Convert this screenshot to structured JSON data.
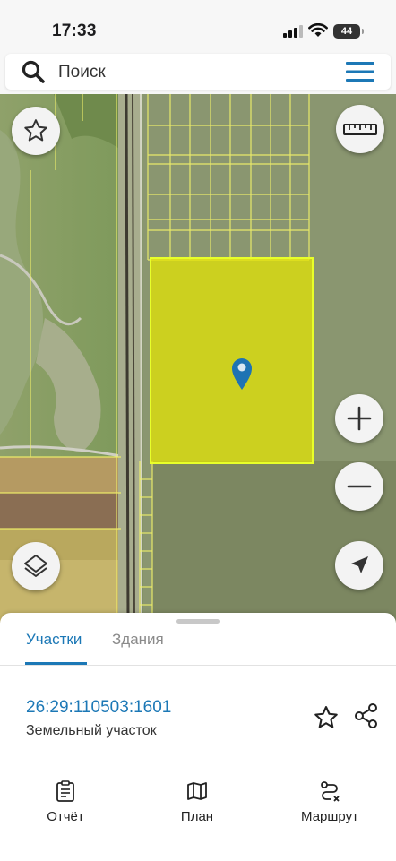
{
  "status_bar": {
    "time": "17:33",
    "battery": "44"
  },
  "search": {
    "placeholder": "Поиск",
    "icon": "search-icon"
  },
  "colors": {
    "accent": "#1c78b6",
    "parcel_fill": "#e6e600",
    "parcel_border": "#e8ff2a",
    "grid_lines": "#f3f36a"
  },
  "sheet": {
    "tabs": [
      {
        "label": "Участки",
        "active": true
      },
      {
        "label": "Здания",
        "active": false
      }
    ],
    "parcel": {
      "cadastral_number": "26:29:110503:1601",
      "type": "Земельный участок"
    }
  },
  "bottom_nav": [
    {
      "label": "Отчёт",
      "icon": "report-icon"
    },
    {
      "label": "План",
      "icon": "map-icon"
    },
    {
      "label": "Маршрут",
      "icon": "route-icon"
    }
  ]
}
